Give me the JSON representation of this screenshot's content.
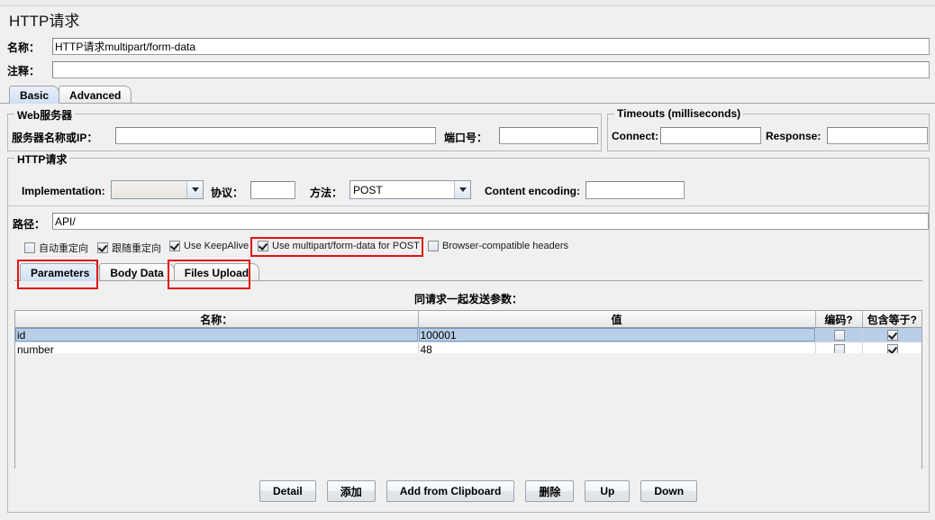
{
  "window": {
    "page_title": "HTTP请求"
  },
  "form": {
    "name_label": "名称：",
    "name_value": "HTTP请求multipart/form-data",
    "comment_label": "注释：",
    "comment_value": ""
  },
  "main_tabs": [
    {
      "label": "Basic",
      "selected": true
    },
    {
      "label": "Advanced",
      "selected": false
    }
  ],
  "web_server": {
    "group_title": "Web服务器",
    "server_label": "服务器名称或IP：",
    "server_value": "",
    "port_label": "端口号：",
    "port_value": ""
  },
  "timeouts": {
    "group_title": "Timeouts (milliseconds)",
    "connect_label": "Connect:",
    "connect_value": "",
    "response_label": "Response:",
    "response_value": ""
  },
  "http_request": {
    "group_title": "HTTP请求",
    "implementation_label": "Implementation:",
    "implementation_value": "",
    "protocol_label": "协议：",
    "protocol_value": "",
    "method_label": "方法：",
    "method_value": "POST",
    "content_encoding_label": "Content encoding:",
    "content_encoding_value": "",
    "path_label": "路径：",
    "path_value": "API/"
  },
  "options": [
    {
      "label": "自动重定向",
      "checked": false
    },
    {
      "label": "跟随重定向",
      "checked": true
    },
    {
      "label": "Use KeepAlive",
      "checked": true
    },
    {
      "label": "Use multipart/form-data for POST",
      "checked": true
    },
    {
      "label": "Browser-compatible headers",
      "checked": false
    }
  ],
  "data_tabs": [
    {
      "label": "Parameters",
      "selected": true
    },
    {
      "label": "Body Data",
      "selected": false
    },
    {
      "label": "Files Upload",
      "selected": false
    }
  ],
  "params_panel": {
    "caption": "同请求一起发送参数：",
    "columns": [
      "名称：",
      "值",
      "编码?",
      "包含等于?"
    ],
    "rows": [
      {
        "name": "id",
        "value": "100001",
        "encode": false,
        "include_equals": true,
        "selected": true
      },
      {
        "name": "number",
        "value": "48",
        "encode": false,
        "include_equals": true,
        "selected": false
      }
    ]
  },
  "buttons": [
    {
      "label": "Detail"
    },
    {
      "label": "添加"
    },
    {
      "label": "Add from Clipboard"
    },
    {
      "label": "删除"
    },
    {
      "label": "Up"
    },
    {
      "label": "Down"
    }
  ],
  "colors": {
    "annotation": "#e21313",
    "selected_row": "#b9cfe8",
    "panel_bg": "#f0f0f0"
  }
}
